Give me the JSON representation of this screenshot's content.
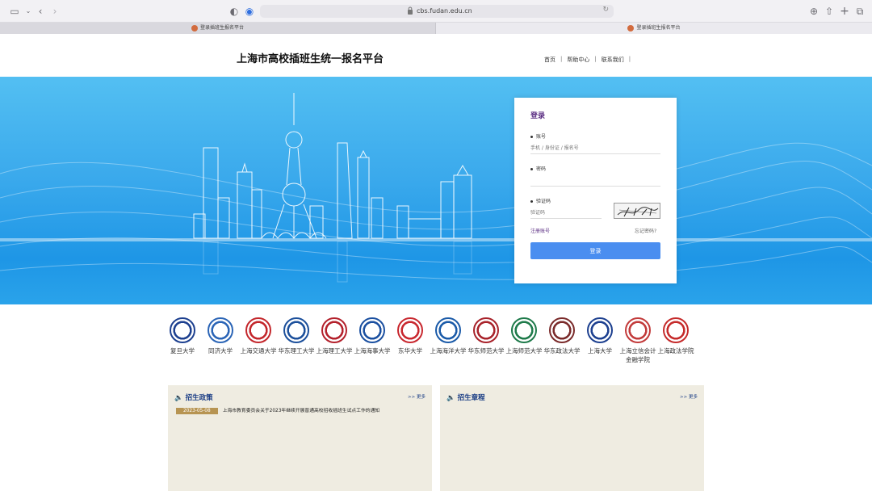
{
  "browser": {
    "url": "cbs.fudan.edu.cn",
    "tabs": [
      {
        "label": "登录插班生报名平台"
      },
      {
        "label": "登录插班生报名平台"
      }
    ]
  },
  "header": {
    "title": "上海市高校插班生统一报名平台",
    "nav": [
      {
        "label": "首页"
      },
      {
        "label": "帮助中心"
      },
      {
        "label": "联系我们"
      }
    ],
    "separator": "|"
  },
  "login": {
    "title": "登录",
    "account_label": "账号",
    "account_placeholder": "手机 / 身份证 / 报名号",
    "password_label": "密码",
    "password_placeholder": "",
    "captcha_label": "验证码",
    "captcha_placeholder": "验证码",
    "register_link": "注册账号",
    "forgot_link": "忘记密码?",
    "submit_label": "登录"
  },
  "universities": [
    {
      "name": "复旦大学",
      "color": "#1c3f8f"
    },
    {
      "name": "同济大学",
      "color": "#2a64b6"
    },
    {
      "name": "上海交通大学",
      "color": "#c3262b"
    },
    {
      "name": "华东理工大学",
      "color": "#1b4f9b"
    },
    {
      "name": "上海理工大学",
      "color": "#b3202b"
    },
    {
      "name": "上海海事大学",
      "color": "#1a4fa0"
    },
    {
      "name": "东华大学",
      "color": "#c8272e"
    },
    {
      "name": "上海海洋大学",
      "color": "#1a5aa8"
    },
    {
      "name": "华东师范大学",
      "color": "#a8222a"
    },
    {
      "name": "上海师范大学",
      "color": "#1e7a4a"
    },
    {
      "name": "华东政法大学",
      "color": "#7a2a2a"
    },
    {
      "name": "上海大学",
      "color": "#1c3f8f"
    },
    {
      "name": "上海立信会计金融学院",
      "color": "#c23a3a"
    },
    {
      "name": "上海政法学院",
      "color": "#c52a2a"
    }
  ],
  "news_policy": {
    "title": "招生政策",
    "more": ">> 更多",
    "items": [
      {
        "date": "2023-05-08",
        "text": "上海市教育委员会关于2023年继续开展普通高校招收插班生试点工作的通知"
      }
    ]
  },
  "news_rules": {
    "title": "招生章程",
    "more": ">> 更多"
  },
  "colors": {
    "accent": "#4a8ef0",
    "brand_purple": "#5a2d82",
    "news_bg": "#efece1",
    "date_badge": "#b79452"
  }
}
